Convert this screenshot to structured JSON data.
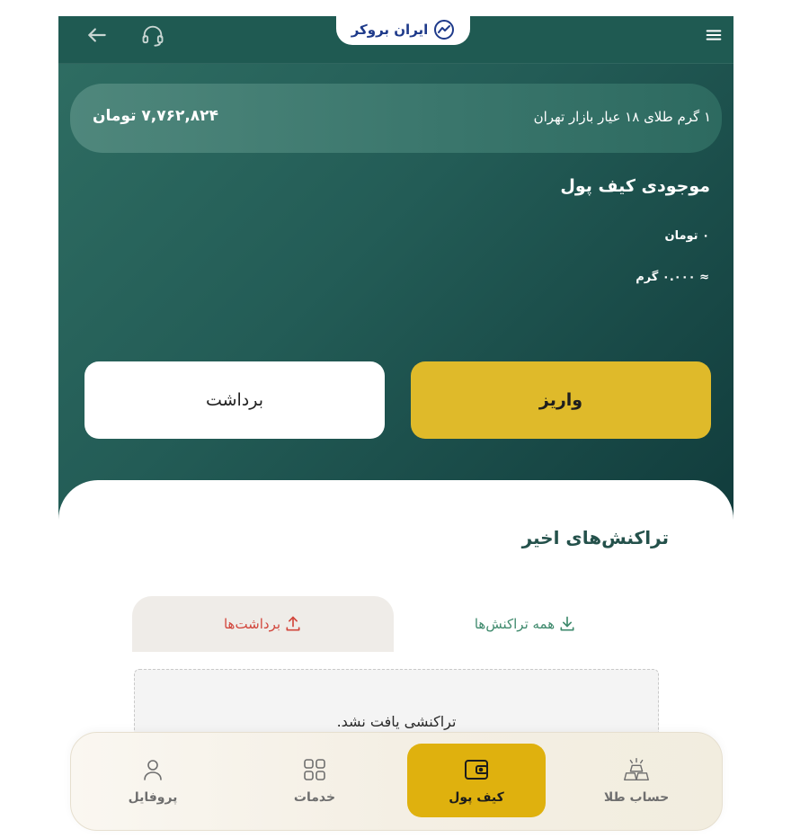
{
  "header": {
    "logo_text": "ایران بروکر"
  },
  "price_ticker": {
    "label": "۱ گرم طلای ۱۸ عیار بازار تهران",
    "value": "۷,۷۶۲,۸۲۴ تومان"
  },
  "wallet": {
    "title": "موجودی کیف پول",
    "toman_balance": "۰ تومان",
    "gram_balance": "≈ ۰.۰۰۰ گرم"
  },
  "actions": {
    "deposit_label": "واریز",
    "withdraw_label": "برداشت"
  },
  "transactions": {
    "title": "تراکنش‌های اخیر",
    "tabs": [
      {
        "label": "همه تراکنش‌ها"
      },
      {
        "label": "برداشت‌ها"
      }
    ],
    "empty_message": "تراکنشی یافت نشد."
  },
  "bottom_nav": {
    "items": [
      {
        "label": "حساب طلا"
      },
      {
        "label": "کیف پول"
      },
      {
        "label": "خدمات"
      },
      {
        "label": "پروفایل"
      }
    ]
  },
  "colors": {
    "primary_green": "#235c56",
    "accent_gold": "#dfba2a",
    "withdraw_red": "#d2463c",
    "tab_green": "#3f8a6d"
  },
  "icons": {
    "back": "arrow-left-icon",
    "support": "headset-icon",
    "menu": "hamburger-menu-icon",
    "logo": "logo-chart-icon",
    "download": "download-icon",
    "upload": "upload-icon",
    "gold": "gold-bars-icon",
    "wallet": "wallet-icon",
    "services": "grid-icon",
    "profile": "user-icon"
  }
}
